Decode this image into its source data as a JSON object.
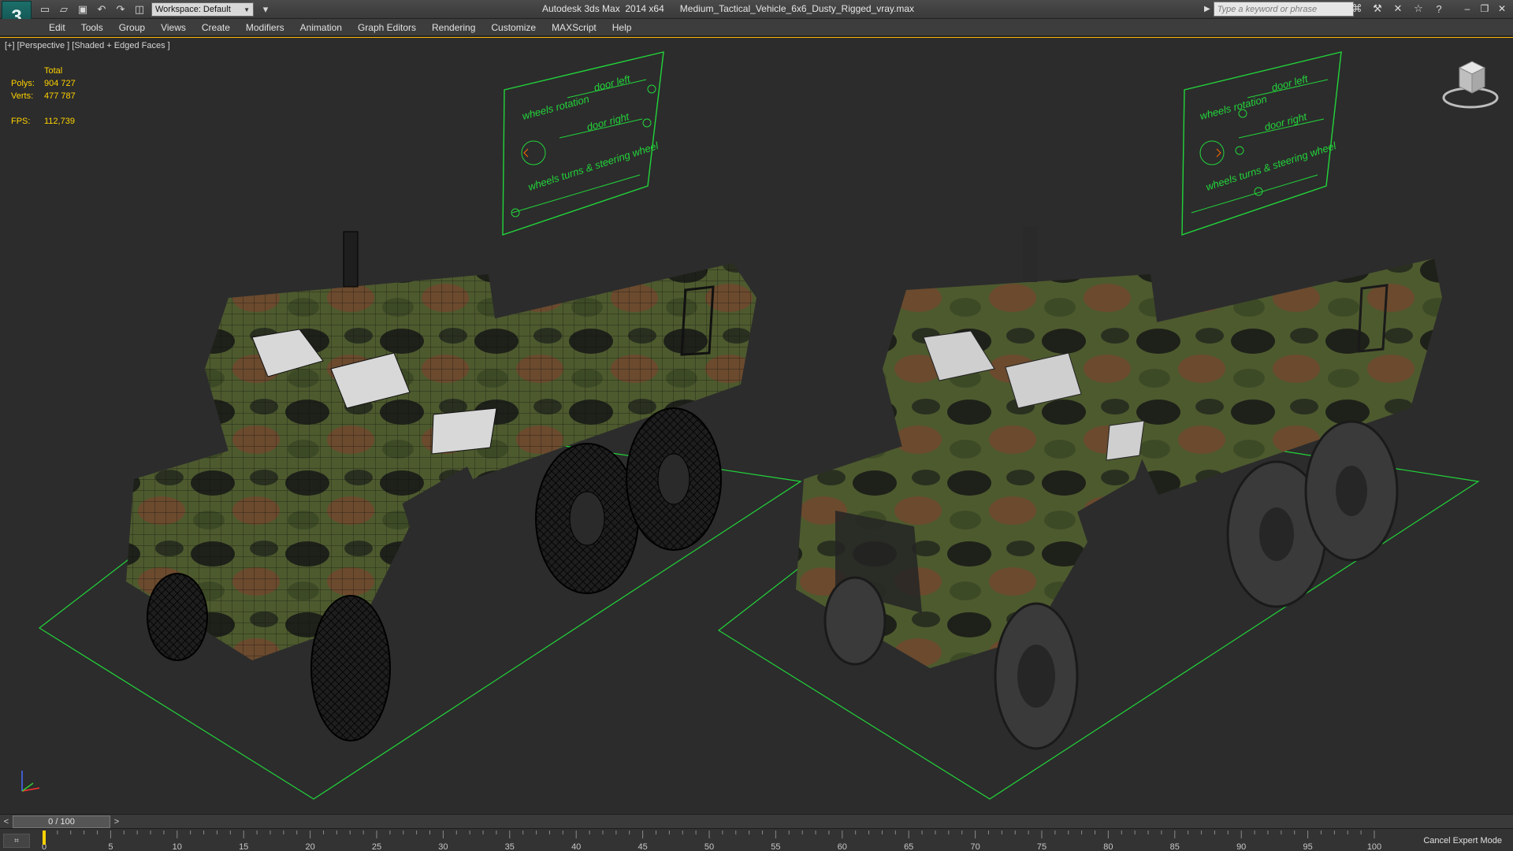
{
  "titlebar": {
    "app_title": "Autodesk 3ds Max  2014 x64",
    "file_name": "Medium_Tactical_Vehicle_6x6_Dusty_Rigged_vray.max",
    "workspace": "Workspace: Default",
    "search_placeholder": "Type a keyword or phrase"
  },
  "menu": {
    "items": [
      "Edit",
      "Tools",
      "Group",
      "Views",
      "Create",
      "Modifiers",
      "Animation",
      "Graph Editors",
      "Rendering",
      "Customize",
      "MAXScript",
      "Help"
    ]
  },
  "viewport": {
    "label": "[+] [Perspective ] [Shaded + Edged Faces ]",
    "stats": {
      "header": "Total",
      "polys_label": "Polys:",
      "polys_value": "904 727",
      "verts_label": "Verts:",
      "verts_value": "477 787",
      "fps_label": "FPS:",
      "fps_value": "112,739"
    },
    "rig_panel": {
      "wheels_rotation": "wheels rotation",
      "door_left": "door left",
      "door_right": "door right",
      "wheels_turns": "wheels turns & steering wheel"
    },
    "accent_color": "#ffb400",
    "helper_color": "#22d53a"
  },
  "timeline": {
    "position": "0 / 100",
    "prev": "<",
    "next": ">",
    "ticks": [
      "0",
      "5",
      "10",
      "15",
      "20",
      "25",
      "30",
      "35",
      "40",
      "45",
      "50",
      "55",
      "60",
      "65",
      "70",
      "75",
      "80",
      "85",
      "90",
      "95",
      "100"
    ]
  },
  "status": {
    "cancel_expert": "Cancel Expert Mode"
  }
}
